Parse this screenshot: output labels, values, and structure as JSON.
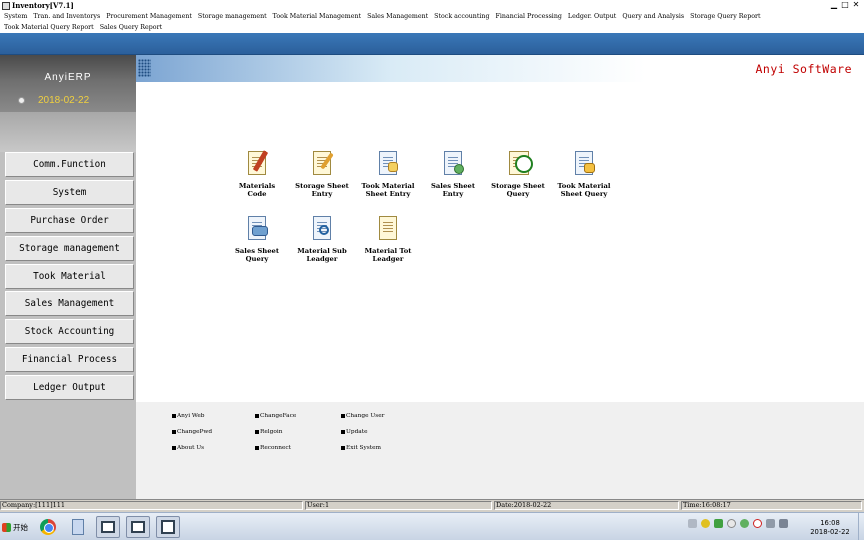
{
  "window": {
    "title": "Inventory[V7.1]"
  },
  "menu_row1": [
    "System",
    "Tran. and Inventorys",
    "Procurement Management",
    "Storage management",
    "Took Material Management",
    "Sales Management",
    "Stock accounting",
    "Financial Processing",
    "Ledger. Output",
    "Query and Analysis",
    "Storage Query Report"
  ],
  "menu_row2": [
    "Took Material Query Report",
    "Sales Query Report"
  ],
  "sidebar": {
    "brand": "AnyiERP",
    "date": "2018-02-22",
    "items": [
      "Comm.Function",
      "System",
      "Purchase Order",
      "Storage management",
      "Took Material",
      "Sales Management",
      "Stock Accounting",
      "Financial Process",
      "Ledger Output"
    ]
  },
  "main": {
    "brand_right": "Anyi SoftWare",
    "launchers": [
      {
        "label": "Materials\nCode",
        "icon": "materials-code-icon"
      },
      {
        "label": "Storage Sheet\nEntry",
        "icon": "storage-entry-icon"
      },
      {
        "label": "Took Material\nSheet Entry",
        "icon": "took-material-entry-icon"
      },
      {
        "label": "Sales Sheet\nEntry",
        "icon": "sales-entry-icon"
      },
      {
        "label": "Storage Sheet\nQuery",
        "icon": "storage-query-icon"
      },
      {
        "label": "Took Material\nSheet Query",
        "icon": "took-material-query-icon"
      },
      {
        "label": "Sales Sheet\nQuery",
        "icon": "sales-query-icon"
      },
      {
        "label": "Material Sub\nLeadger",
        "icon": "material-sub-ledger-icon"
      },
      {
        "label": "Material Tot\nLeadger",
        "icon": "material-total-ledger-icon"
      }
    ]
  },
  "links": {
    "anyi_web": "Anyi Web",
    "change_face": "ChangeFace",
    "change_user": "Change User",
    "change_pwd": "ChangePwd",
    "relogin": "Relgoin",
    "update": "Update",
    "about": "About Us",
    "reconnect": "Reconnect",
    "exit": "Exit System"
  },
  "status": {
    "company": "Company:[111]111",
    "user": "User:1",
    "date": "Date:2018-02-22",
    "time": "Time:16:08:17"
  },
  "taskbar": {
    "start": "开始",
    "clock_time": "16:08",
    "clock_date": "2018-02-22"
  },
  "colors": {
    "band_blue": "#2b5f9b",
    "brand_red": "#c00000",
    "sidebar_date": "#f0d040"
  }
}
